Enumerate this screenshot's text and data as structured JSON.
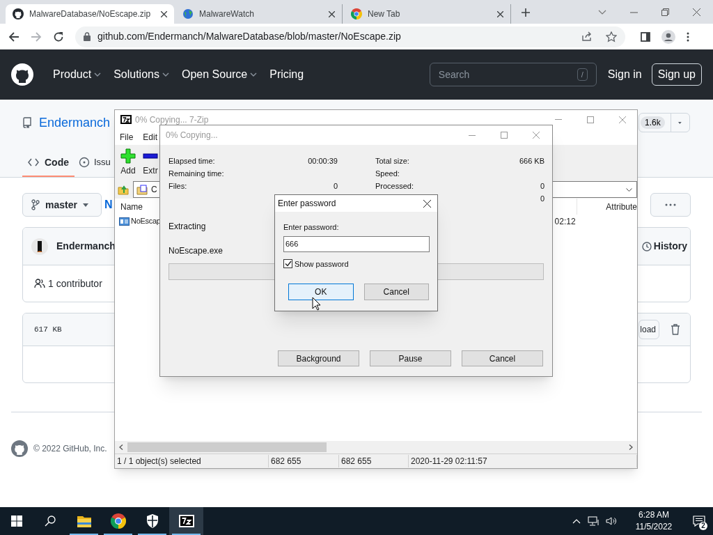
{
  "browser": {
    "tabs": [
      {
        "kind": "github",
        "title": "MalwareDatabase/NoEscape.zip",
        "selected": true
      },
      {
        "kind": "globe",
        "title": "MalwareWatch",
        "selected": false
      },
      {
        "kind": "chrome",
        "title": "New Tab",
        "selected": false
      }
    ],
    "url": "github.com/Endermanch/MalwareDatabase/blob/master/NoEscape.zip"
  },
  "github": {
    "nav": [
      {
        "label": "Product",
        "dropdown": true
      },
      {
        "label": "Solutions",
        "dropdown": true
      },
      {
        "label": "Open Source",
        "dropdown": true
      },
      {
        "label": "Pricing",
        "dropdown": false
      }
    ],
    "search_placeholder": "Search",
    "search_key": "/",
    "sign_in": "Sign in",
    "sign_up": "Sign up",
    "repo_owner": "Endermanch",
    "star_count": "1.6k",
    "repo_tabs": [
      {
        "kind": "code",
        "label": "Code",
        "selected": true
      },
      {
        "kind": "issues",
        "label": "Issu",
        "selected": false
      }
    ],
    "branch": "master",
    "path_fragment": "N",
    "commit_author": "Endermanch",
    "history": "History",
    "contributors": "1 contributor",
    "file_size": "617 KB",
    "download": "load",
    "footer": "© 2022 GitHub, Inc."
  },
  "sevenzip": {
    "title": "0% Copying... 7-Zip",
    "menu": [
      "File",
      "Edit"
    ],
    "toolbar": [
      {
        "kind": "add",
        "label": "Add"
      },
      {
        "kind": "extract",
        "label": "Extr"
      }
    ],
    "address": "C",
    "columns": [
      "Name",
      "Attribute"
    ],
    "row": {
      "name": "NoEscap",
      "time": "02:12"
    },
    "status": [
      "1 / 1 object(s) selected",
      "682 655",
      "682 655",
      "2020-11-29 02:11:57"
    ]
  },
  "progress": {
    "title": "0% Copying...",
    "left_stats": [
      {
        "label": "Elapsed time:",
        "value": "00:00:39"
      },
      {
        "label": "Remaining time:"
      },
      {
        "label": "Files:",
        "value": "0"
      }
    ],
    "right_stats": [
      {
        "label": "Total size:",
        "value": "666 KB"
      },
      {
        "label": "Speed:"
      },
      {
        "label": "Processed:",
        "value": "0"
      },
      {
        "value": "0"
      }
    ],
    "operation": "Extracting",
    "file": "NoEscape.exe",
    "level": 0,
    "buttons": [
      "Background",
      "Pause",
      "Cancel"
    ]
  },
  "password_dialog": {
    "title": "Enter password",
    "label": "Enter password:",
    "value": "666",
    "show_password": {
      "label": "Show password",
      "checked": true
    },
    "buttons": [
      {
        "label": "OK",
        "focused": true
      },
      {
        "label": "Cancel",
        "focused": false
      }
    ]
  },
  "taskbar": {
    "apps": [
      {
        "kind": "folder",
        "running": true,
        "active": false
      },
      {
        "kind": "chrome",
        "running": true,
        "active": false
      },
      {
        "kind": "shield",
        "running": true,
        "active": false
      },
      {
        "kind": "sevenzip",
        "running": true,
        "active": true
      }
    ],
    "time": "6:28 AM",
    "date": "11/5/2022",
    "notifications": "2"
  }
}
